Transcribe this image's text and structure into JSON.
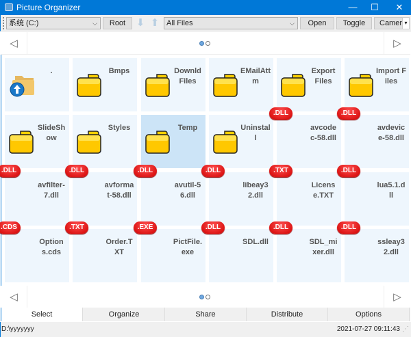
{
  "window": {
    "title": "Picture Organizer",
    "minimize": "—",
    "maximize": "☐",
    "close": "✕"
  },
  "toolbar": {
    "drive": "系统 (C:)",
    "root": "Root",
    "filter": "All Files",
    "open": "Open",
    "toggle": "Toggle",
    "camera": "Camera",
    "overflow": "▾"
  },
  "pager": {
    "prev": "◁",
    "next": "▷",
    "pages": 2,
    "current": 1
  },
  "tiles": [
    {
      "name": ".",
      "type": "up"
    },
    {
      "name": "Bmps",
      "type": "folder"
    },
    {
      "name": "DownldFiles",
      "type": "folder"
    },
    {
      "name": "EMailAttm",
      "type": "folder"
    },
    {
      "name": "Export Files",
      "type": "folder"
    },
    {
      "name": "Import Files",
      "type": "folder"
    },
    {
      "name": "SlideShow",
      "type": "folder"
    },
    {
      "name": "Styles",
      "type": "folder"
    },
    {
      "name": "Temp",
      "type": "folder",
      "selected": true
    },
    {
      "name": "Uninstall",
      "type": "folder"
    },
    {
      "name": "avcodec-58.dll",
      "type": "file",
      "badge": ".DLL"
    },
    {
      "name": "avdevice-58.dll",
      "type": "file",
      "badge": ".DLL"
    },
    {
      "name": "avfilter-7.dll",
      "type": "file",
      "badge": ".DLL"
    },
    {
      "name": "avformat-58.dll",
      "type": "file",
      "badge": ".DLL"
    },
    {
      "name": "avutil-56.dll",
      "type": "file",
      "badge": ".DLL"
    },
    {
      "name": "libeay32.dll",
      "type": "file",
      "badge": ".DLL"
    },
    {
      "name": "License.TXT",
      "type": "file",
      "badge": ".TXT"
    },
    {
      "name": "lua5.1.dll",
      "type": "file",
      "badge": ".DLL"
    },
    {
      "name": "Options.cds",
      "type": "file",
      "badge": ".CDS"
    },
    {
      "name": "Order.TXT",
      "type": "file",
      "badge": ".TXT"
    },
    {
      "name": "PictFile.exe",
      "type": "file",
      "badge": ".EXE"
    },
    {
      "name": "SDL.dll",
      "type": "file",
      "badge": ".DLL"
    },
    {
      "name": "SDL_mixer.dll",
      "type": "file",
      "badge": ".DLL"
    },
    {
      "name": "ssleay32.dll",
      "type": "file",
      "badge": ".DLL"
    }
  ],
  "tabs": [
    "Select",
    "Organize",
    "Share",
    "Distribute",
    "Options"
  ],
  "active_tab": "Select",
  "status": {
    "path": "D:\\yyyyyyy",
    "datetime": "2021-07-27 09:11:43"
  }
}
